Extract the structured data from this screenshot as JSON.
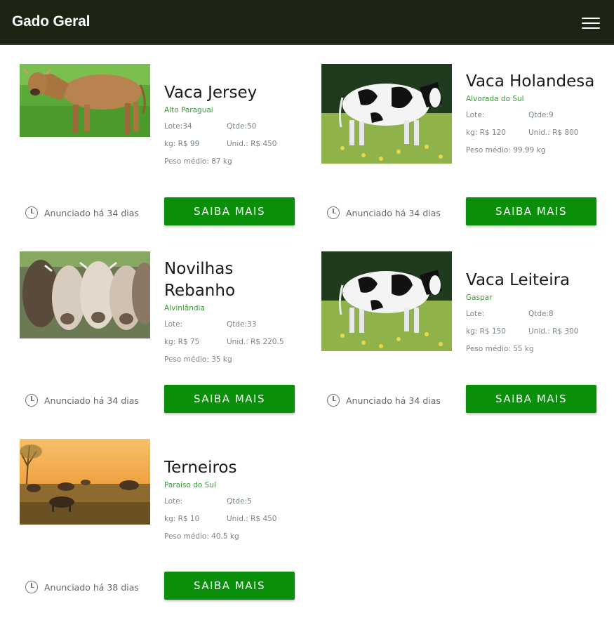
{
  "app": {
    "brand": "Gado Geral"
  },
  "labels": {
    "button": "SAIBA MAIS"
  },
  "listings": [
    {
      "title": "Vaca Jersey",
      "location": "Alto Paraguai",
      "lote": "Lote:34",
      "qtde": "Qtde:50",
      "kg": "kg: R$ 99",
      "unid": "Unid.: R$ 450",
      "peso": "Peso médio: 87 kg",
      "posted": "Anunciado há 34 dias",
      "photo": "jersey-cow"
    },
    {
      "title": "Vaca Holandesa",
      "location": "Alvorada do Sul",
      "lote": "Lote:",
      "qtde": "Qtde:9",
      "kg": "kg: R$ 120",
      "unid": "Unid.: R$ 800",
      "peso": "Peso médio: 99.99 kg",
      "posted": "Anunciado há 34 dias",
      "photo": "holstein-cow"
    },
    {
      "title": "Novilhas Rebanho",
      "location": "Alvinlândia",
      "lote": "Lote:",
      "qtde": "Qtde:33",
      "kg": "kg: R$ 75",
      "unid": "Unid.: R$ 220.5",
      "peso": "Peso médio: 35 kg",
      "posted": "Anunciado há 34 dias",
      "photo": "herd-cows"
    },
    {
      "title": "Vaca Leiteira",
      "location": "Gaspar",
      "lote": "Lote:",
      "qtde": "Qtde:8",
      "kg": "kg: R$ 150",
      "unid": "Unid.: R$ 300",
      "peso": "Peso médio: 55 kg",
      "posted": "Anunciado há 34 dias",
      "photo": "holstein-cow"
    },
    {
      "title": "Terneiros",
      "location": "Paraíso do Sul",
      "lote": "Lote:",
      "qtde": "Qtde:5",
      "kg": "kg: R$ 10",
      "unid": "Unid.: R$ 450",
      "peso": "Peso médio: 40.5 kg",
      "posted": "Anunciado há 38 dias",
      "photo": "sunset-calves"
    }
  ]
}
